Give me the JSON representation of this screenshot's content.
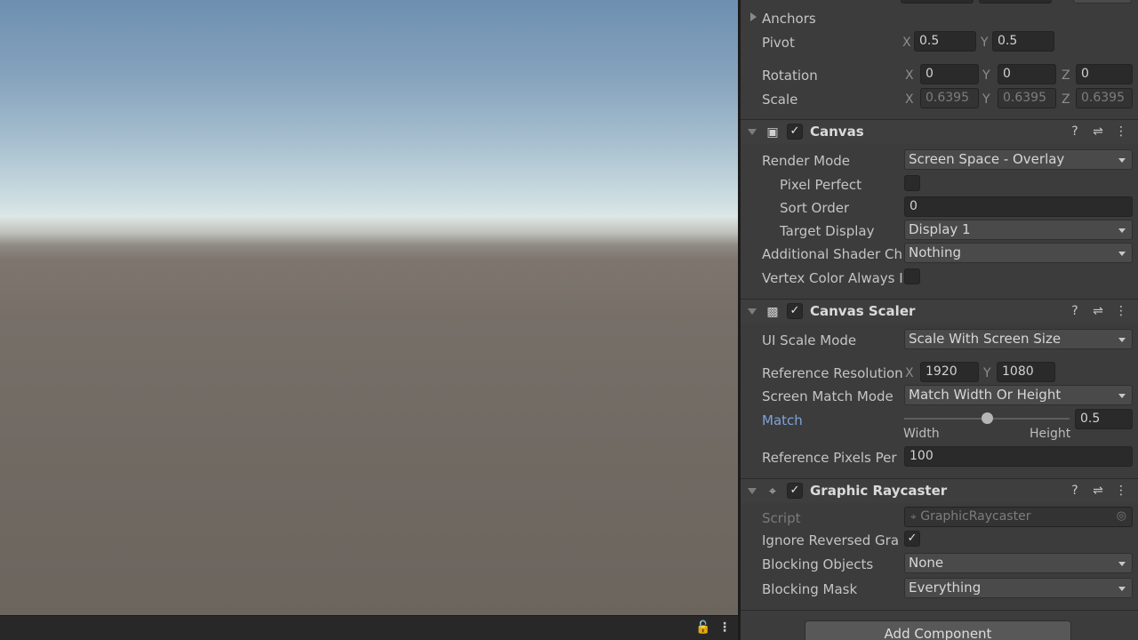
{
  "scene": {
    "lock_icon": "lock-icon",
    "menu_icon": "kebab-menu-icon"
  },
  "transform": {
    "anchors_label": "Anchors",
    "pivot": {
      "label": "Pivot",
      "x_axis": "X",
      "x": "0.5",
      "y_axis": "Y",
      "y": "0.5"
    },
    "rotation": {
      "label": "Rotation",
      "x_axis": "X",
      "x": "0",
      "y_axis": "Y",
      "y": "0",
      "z_axis": "Z",
      "z": "0"
    },
    "scale": {
      "label": "Scale",
      "x_axis": "X",
      "x": "0.6395",
      "y_axis": "Y",
      "y": "0.6395",
      "z_axis": "Z",
      "z": "0.6395"
    }
  },
  "canvas": {
    "title": "Canvas",
    "enabled": true,
    "render_mode": {
      "label": "Render Mode",
      "value": "Screen Space - Overlay"
    },
    "pixel_perfect": {
      "label": "Pixel Perfect",
      "checked": false
    },
    "sort_order": {
      "label": "Sort Order",
      "value": "0"
    },
    "target_display": {
      "label": "Target Display",
      "value": "Display 1"
    },
    "additional_shader": {
      "label": "Additional Shader Ch",
      "value": "Nothing"
    },
    "vertex_color": {
      "label": "Vertex Color Always I",
      "checked": false
    }
  },
  "canvas_scaler": {
    "title": "Canvas Scaler",
    "enabled": true,
    "ui_scale_mode": {
      "label": "UI Scale Mode",
      "value": "Scale With Screen Size"
    },
    "reference_resolution": {
      "label": "Reference Resolution",
      "x_axis": "X",
      "x": "1920",
      "y_axis": "Y",
      "y": "1080"
    },
    "screen_match_mode": {
      "label": "Screen Match Mode",
      "value": "Match Width Or Height"
    },
    "match": {
      "label": "Match",
      "value": "0.5",
      "level": 0.5,
      "min_label": "Width",
      "max_label": "Height"
    },
    "reference_pixels": {
      "label": "Reference Pixels Per",
      "value": "100"
    }
  },
  "graphic_raycaster": {
    "title": "Graphic Raycaster",
    "enabled": true,
    "script": {
      "label": "Script",
      "value": "GraphicRaycaster"
    },
    "ignore_reversed": {
      "label": "Ignore Reversed Gra",
      "checked": true
    },
    "blocking_objects": {
      "label": "Blocking Objects",
      "value": "None"
    },
    "blocking_mask": {
      "label": "Blocking Mask",
      "value": "Everything"
    }
  },
  "add_component_label": "Add Component",
  "check_glyph": "✓",
  "header_icons": {
    "help": "?",
    "preset": "⇌",
    "menu": "⋮"
  }
}
